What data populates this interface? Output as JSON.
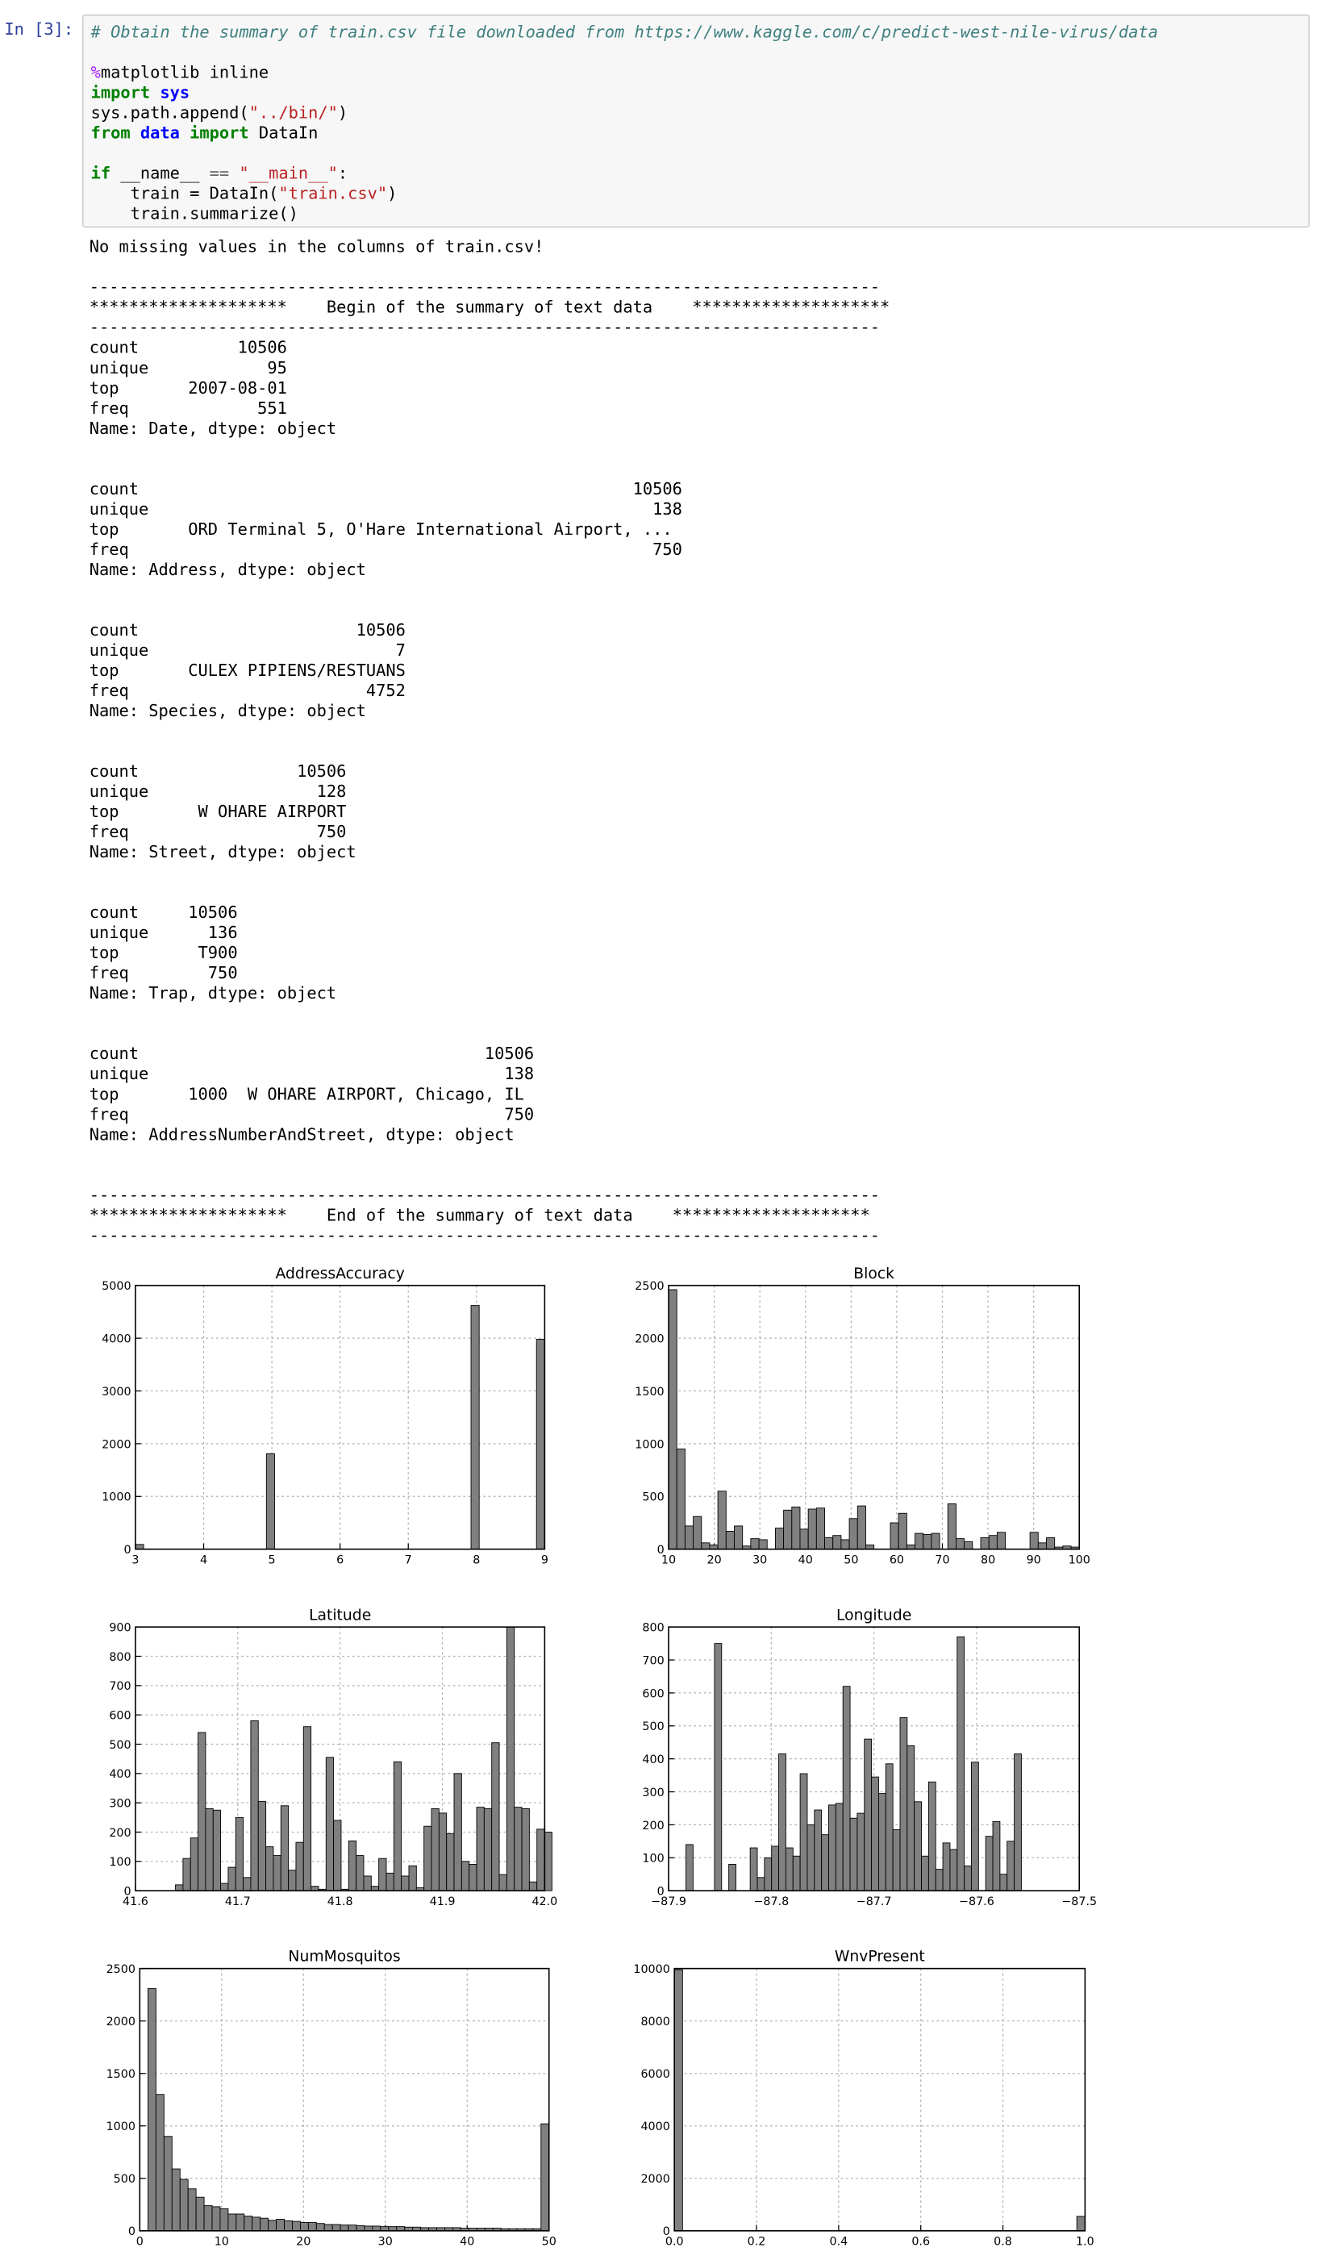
{
  "cell": {
    "prompt": "In [3]:",
    "comment": "# Obtain the summary of train.csv file downloaded from https://www.kaggle.com/c/predict-west-nile-virus/data",
    "line_magic_sym": "%",
    "line_magic": "matplotlib inline",
    "kw_import": "import",
    "mod_sys": "sys",
    "line_path_pre": "sys.path.append(",
    "line_path_str": "\"../bin/\"",
    "line_path_post": ")",
    "kw_from": "from",
    "mod_data": "data",
    "import_name": "DataIn",
    "kw_if": "if",
    "if_name": "__name__",
    "if_op": "==",
    "if_str": "\"__main__\"",
    "if_colon": ":",
    "train_pre": "    train = DataIn(",
    "train_str": "\"train.csv\"",
    "train_post": ")",
    "summarize": "    train.summarize()"
  },
  "output": {
    "lines": [
      "No missing values in the columns of train.csv!",
      "",
      "--------------------------------------------------------------------------------",
      "********************    Begin of the summary of text data    ********************",
      "--------------------------------------------------------------------------------",
      "count          10506",
      "unique            95",
      "top       2007-08-01",
      "freq             551",
      "Name: Date, dtype: object",
      "",
      "",
      "count                                                  10506",
      "unique                                                   138",
      "top       ORD Terminal 5, O'Hare International Airport, ...",
      "freq                                                     750",
      "Name: Address, dtype: object",
      "",
      "",
      "count                      10506",
      "unique                         7",
      "top       CULEX PIPIENS/RESTUANS",
      "freq                        4752",
      "Name: Species, dtype: object",
      "",
      "",
      "count                10506",
      "unique                 128",
      "top        W OHARE AIRPORT",
      "freq                   750",
      "Name: Street, dtype: object",
      "",
      "",
      "count     10506",
      "unique      136",
      "top        T900",
      "freq        750",
      "Name: Trap, dtype: object",
      "",
      "",
      "count                                   10506",
      "unique                                    138",
      "top       1000  W OHARE AIRPORT, Chicago, IL",
      "freq                                      750",
      "Name: AddressNumberAndStreet, dtype: object",
      "",
      "",
      "--------------------------------------------------------------------------------",
      "********************    End of the summary of text data    ********************",
      "--------------------------------------------------------------------------------"
    ]
  },
  "colors": {
    "bar_fill": "#808080",
    "bar_edge": "#000000",
    "grid": "#b0b0b0",
    "prompt": "#303f9f",
    "code_bg": "#f7f7f7"
  },
  "chart_data": [
    {
      "type": "bar",
      "title": "AddressAccuracy",
      "xlim": [
        3,
        9
      ],
      "ylim": [
        0,
        5000
      ],
      "xticks": [
        "3",
        "4",
        "5",
        "6",
        "7",
        "8",
        "9"
      ],
      "yticks": [
        "0",
        "1000",
        "2000",
        "3000",
        "4000",
        "5000"
      ],
      "bins": [
        [
          3.0,
          3.12,
          90
        ],
        [
          4.92,
          5.04,
          1810
        ],
        [
          7.92,
          8.04,
          4620
        ],
        [
          8.88,
          9.0,
          3980
        ]
      ]
    },
    {
      "type": "bar",
      "title": "Block",
      "xlim": [
        10,
        100
      ],
      "ylim": [
        0,
        2500
      ],
      "xticks": [
        "10",
        "20",
        "30",
        "40",
        "50",
        "60",
        "70",
        "80",
        "90",
        "100"
      ],
      "yticks": [
        "0",
        "500",
        "1000",
        "1500",
        "2000",
        "2500"
      ],
      "bin_start": 10,
      "bin_width": 1.8,
      "values": [
        2460,
        950,
        220,
        310,
        60,
        40,
        550,
        170,
        220,
        30,
        100,
        90,
        0,
        200,
        370,
        400,
        190,
        380,
        390,
        110,
        130,
        90,
        290,
        410,
        40,
        0,
        0,
        250,
        340,
        40,
        150,
        140,
        150,
        0,
        430,
        100,
        70,
        0,
        110,
        130,
        160,
        0,
        0,
        0,
        160,
        60,
        110,
        20,
        30,
        20
      ]
    },
    {
      "type": "bar",
      "title": "Latitude",
      "xlim": [
        41.6,
        42.05
      ],
      "ylim": [
        0,
        900
      ],
      "xticks": [
        "41.6",
        "41.7",
        "41.8",
        "41.9",
        "42.0"
      ],
      "yticks": [
        "0",
        "100",
        "200",
        "300",
        "400",
        "500",
        "600",
        "700",
        "800",
        "900"
      ],
      "bin_start": 41.644,
      "bin_width": 0.00828,
      "values": [
        20,
        110,
        180,
        540,
        280,
        275,
        25,
        80,
        250,
        45,
        580,
        305,
        150,
        120,
        290,
        70,
        165,
        560,
        15,
        5,
        455,
        240,
        5,
        170,
        120,
        50,
        15,
        110,
        60,
        440,
        50,
        85,
        10,
        220,
        280,
        265,
        195,
        400,
        100,
        90,
        285,
        280,
        505,
        55,
        900,
        285,
        280,
        30,
        210,
        200
      ]
    },
    {
      "type": "bar",
      "title": "Longitude",
      "xlim": [
        -87.95,
        -87.5
      ],
      "ylim": [
        0,
        800
      ],
      "xticks": [
        "−87.9",
        "−87.8",
        "−87.7",
        "−87.6",
        "−87.5"
      ],
      "yticks": [
        "0",
        "100",
        "200",
        "300",
        "400",
        "500",
        "600",
        "700",
        "800"
      ],
      "bin_start": -87.931,
      "bin_width": 0.00782,
      "values": [
        140,
        0,
        0,
        0,
        750,
        0,
        80,
        0,
        0,
        130,
        40,
        100,
        135,
        415,
        130,
        105,
        355,
        200,
        245,
        170,
        260,
        265,
        620,
        220,
        235,
        460,
        345,
        295,
        385,
        185,
        525,
        440,
        270,
        105,
        330,
        65,
        145,
        125,
        770,
        75,
        390,
        0,
        165,
        210,
        50,
        150,
        415
      ]
    },
    {
      "type": "bar",
      "title": "NumMosquitos",
      "xlim": [
        0,
        50
      ],
      "ylim": [
        0,
        2500
      ],
      "xticks": [
        "0",
        "10",
        "20",
        "30",
        "40",
        "50"
      ],
      "yticks": [
        "0",
        "500",
        "1000",
        "1500",
        "2000",
        "2500"
      ],
      "bin_start": 1,
      "bin_width": 0.98,
      "values": [
        2310,
        1300,
        900,
        590,
        490,
        400,
        320,
        240,
        230,
        210,
        160,
        160,
        140,
        130,
        120,
        100,
        110,
        95,
        90,
        80,
        80,
        70,
        60,
        60,
        55,
        55,
        50,
        45,
        45,
        40,
        40,
        40,
        35,
        35,
        30,
        30,
        30,
        30,
        30,
        25,
        25,
        25,
        25,
        25,
        20,
        20,
        20,
        20,
        20,
        1020
      ]
    },
    {
      "type": "bar",
      "title": "WnvPresent",
      "xlim": [
        0.0,
        1.0
      ],
      "ylim": [
        0,
        10000
      ],
      "xticks": [
        "0.0",
        "0.2",
        "0.4",
        "0.6",
        "0.8",
        "1.0"
      ],
      "yticks": [
        "0",
        "2000",
        "4000",
        "6000",
        "8000",
        "10000"
      ],
      "bins": [
        [
          0.0,
          0.02,
          9955
        ],
        [
          0.98,
          1.0,
          551
        ]
      ]
    }
  ]
}
